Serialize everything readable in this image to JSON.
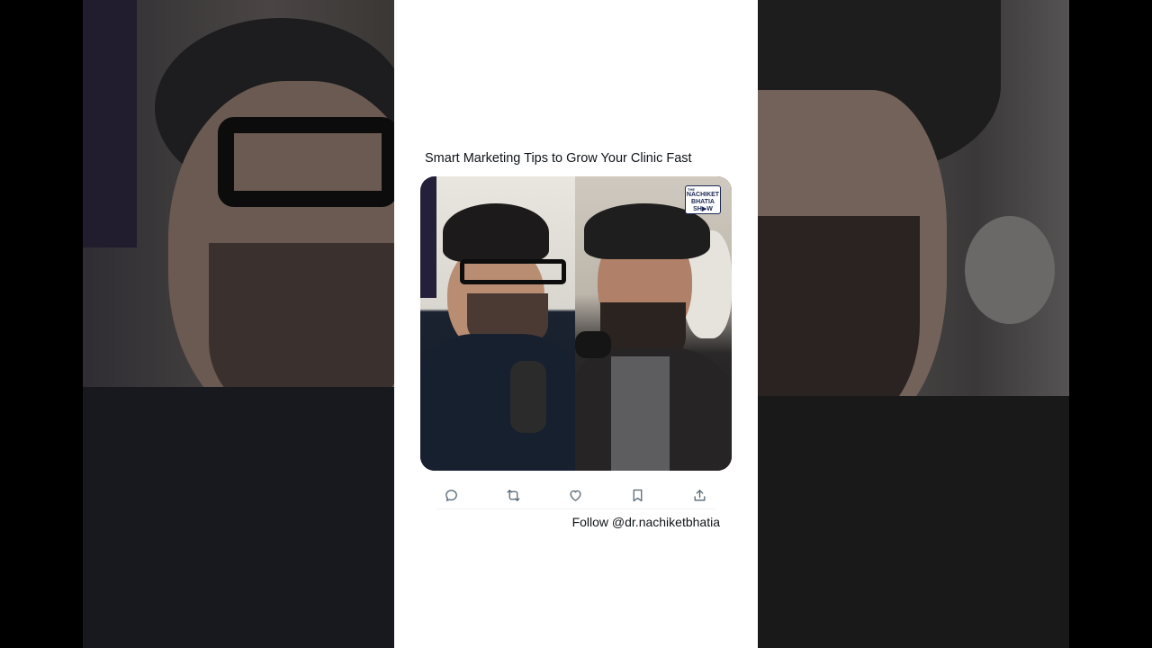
{
  "post": {
    "title": "Smart Marketing Tips to Grow Your Clinic Fast",
    "follow_text": "Follow @dr.nachiketbhatia"
  },
  "logo": {
    "line1": "THE",
    "line2": "NACHIKET",
    "line3": "BHATIA",
    "line4": "SH▶W"
  },
  "actions": [
    {
      "name": "reply-icon"
    },
    {
      "name": "repost-icon"
    },
    {
      "name": "like-icon"
    },
    {
      "name": "bookmark-icon"
    },
    {
      "name": "share-icon"
    }
  ],
  "colors": {
    "card_background": "#ffffff",
    "text": "#0f1419",
    "icon": "#536471",
    "logo_accent": "#1d2a55"
  }
}
